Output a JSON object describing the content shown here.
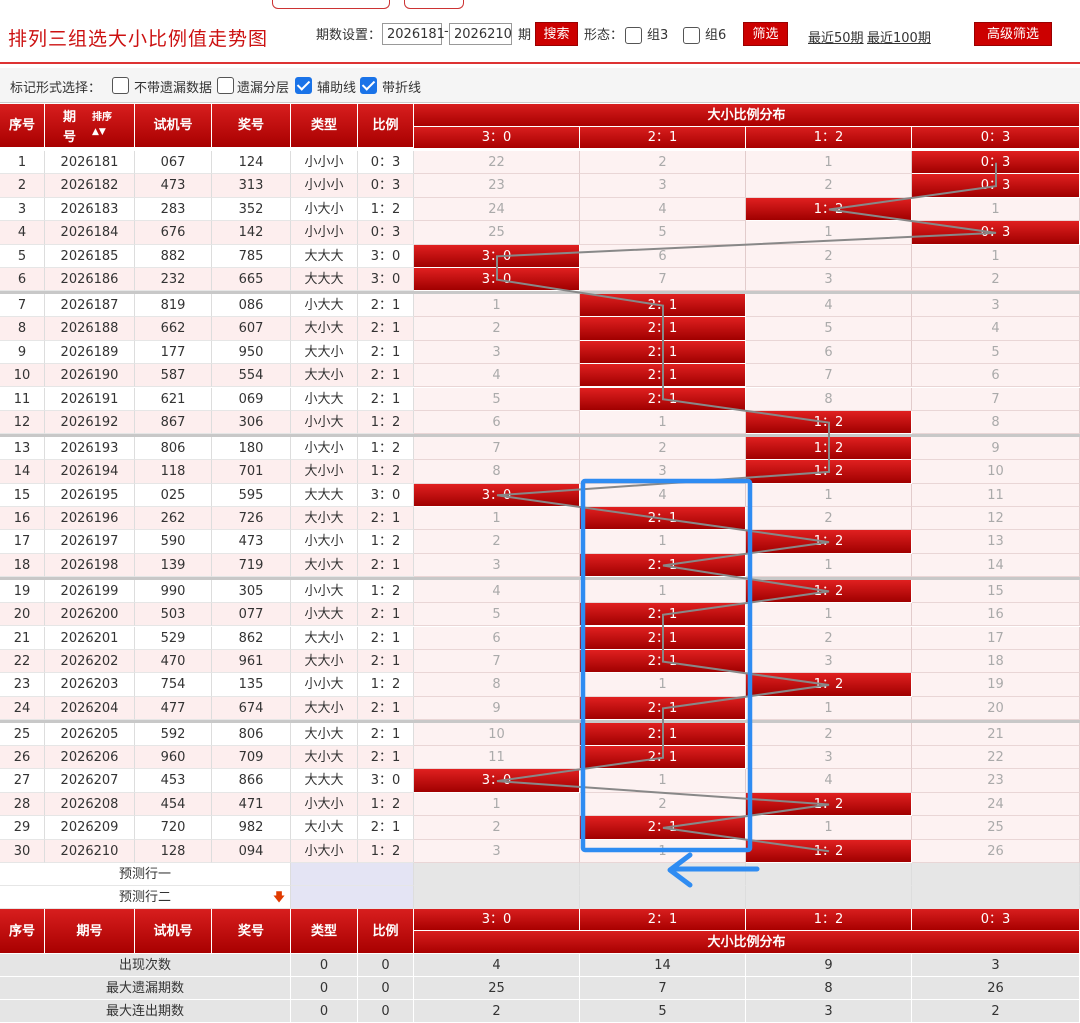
{
  "header": {
    "title": "排列三组选大小比例值走势图",
    "period_label": "期数设置：",
    "period_from": "2026181",
    "dash": "-",
    "period_to": "2026210",
    "period_unit": "期",
    "search_btn": "搜索",
    "form_label": "形态：",
    "g3_label": "组3",
    "g6_label": "组6",
    "filter_btn": "筛选",
    "recent50": "最近50期",
    "recent100": "最近100期",
    "advanced_btn": "高级筛选"
  },
  "markbar": {
    "label": "标记形式选择：",
    "opt1": "不带遗漏数据",
    "opt2": "遗漏分层",
    "opt3": "辅助线",
    "opt4": "带折线",
    "opt1_checked": false,
    "opt2_checked": false,
    "opt3_checked": true,
    "opt4_checked": true
  },
  "table": {
    "h_seq": "序号",
    "h_issue_1": "期",
    "h_issue_2": "号",
    "h_sort": "排序",
    "h_test": "试机号",
    "h_prize": "奖号",
    "h_type": "类型",
    "h_ratio": "比例",
    "h_group": "大小比例分布",
    "cols": [
      "3：0",
      "2：1",
      "1：2",
      "0：3"
    ],
    "rows": [
      {
        "seq": "1",
        "issue": "2026181",
        "test": "067",
        "prize": "124",
        "type": "小小小",
        "ratio": "0：3",
        "hit": 3,
        "cells": [
          "22",
          "2",
          "1",
          "0：3"
        ]
      },
      {
        "seq": "2",
        "issue": "2026182",
        "test": "473",
        "prize": "313",
        "type": "小小小",
        "ratio": "0：3",
        "hit": 3,
        "cells": [
          "23",
          "3",
          "2",
          "0：3"
        ]
      },
      {
        "seq": "3",
        "issue": "2026183",
        "test": "283",
        "prize": "352",
        "type": "小大小",
        "ratio": "1：2",
        "hit": 2,
        "cells": [
          "24",
          "4",
          "1：2",
          "1"
        ]
      },
      {
        "seq": "4",
        "issue": "2026184",
        "test": "676",
        "prize": "142",
        "type": "小小小",
        "ratio": "0：3",
        "hit": 3,
        "cells": [
          "25",
          "5",
          "1",
          "0：3"
        ]
      },
      {
        "seq": "5",
        "issue": "2026185",
        "test": "882",
        "prize": "785",
        "type": "大大大",
        "ratio": "3：0",
        "hit": 0,
        "cells": [
          "3：0",
          "6",
          "2",
          "1"
        ]
      },
      {
        "seq": "6",
        "issue": "2026186",
        "test": "232",
        "prize": "665",
        "type": "大大大",
        "ratio": "3：0",
        "hit": 0,
        "cells": [
          "3：0",
          "7",
          "3",
          "2"
        ]
      },
      {
        "seq": "7",
        "issue": "2026187",
        "test": "819",
        "prize": "086",
        "type": "小大大",
        "ratio": "2：1",
        "hit": 1,
        "cells": [
          "1",
          "2：1",
          "4",
          "3"
        ]
      },
      {
        "seq": "8",
        "issue": "2026188",
        "test": "662",
        "prize": "607",
        "type": "大小大",
        "ratio": "2：1",
        "hit": 1,
        "cells": [
          "2",
          "2：1",
          "5",
          "4"
        ]
      },
      {
        "seq": "9",
        "issue": "2026189",
        "test": "177",
        "prize": "950",
        "type": "大大小",
        "ratio": "2：1",
        "hit": 1,
        "cells": [
          "3",
          "2：1",
          "6",
          "5"
        ]
      },
      {
        "seq": "10",
        "issue": "2026190",
        "test": "587",
        "prize": "554",
        "type": "大大小",
        "ratio": "2：1",
        "hit": 1,
        "cells": [
          "4",
          "2：1",
          "7",
          "6"
        ]
      },
      {
        "seq": "11",
        "issue": "2026191",
        "test": "621",
        "prize": "069",
        "type": "小大大",
        "ratio": "2：1",
        "hit": 1,
        "cells": [
          "5",
          "2：1",
          "8",
          "7"
        ]
      },
      {
        "seq": "12",
        "issue": "2026192",
        "test": "867",
        "prize": "306",
        "type": "小小大",
        "ratio": "1：2",
        "hit": 2,
        "cells": [
          "6",
          "1",
          "1：2",
          "8"
        ]
      },
      {
        "seq": "13",
        "issue": "2026193",
        "test": "806",
        "prize": "180",
        "type": "小大小",
        "ratio": "1：2",
        "hit": 2,
        "cells": [
          "7",
          "2",
          "1：2",
          "9"
        ]
      },
      {
        "seq": "14",
        "issue": "2026194",
        "test": "118",
        "prize": "701",
        "type": "大小小",
        "ratio": "1：2",
        "hit": 2,
        "cells": [
          "8",
          "3",
          "1：2",
          "10"
        ]
      },
      {
        "seq": "15",
        "issue": "2026195",
        "test": "025",
        "prize": "595",
        "type": "大大大",
        "ratio": "3：0",
        "hit": 0,
        "cells": [
          "3：0",
          "4",
          "1",
          "11"
        ]
      },
      {
        "seq": "16",
        "issue": "2026196",
        "test": "262",
        "prize": "726",
        "type": "大小大",
        "ratio": "2：1",
        "hit": 1,
        "cells": [
          "1",
          "2：1",
          "2",
          "12"
        ]
      },
      {
        "seq": "17",
        "issue": "2026197",
        "test": "590",
        "prize": "473",
        "type": "小大小",
        "ratio": "1：2",
        "hit": 2,
        "cells": [
          "2",
          "1",
          "1：2",
          "13"
        ]
      },
      {
        "seq": "18",
        "issue": "2026198",
        "test": "139",
        "prize": "719",
        "type": "大小大",
        "ratio": "2：1",
        "hit": 1,
        "cells": [
          "3",
          "2：1",
          "1",
          "14"
        ]
      },
      {
        "seq": "19",
        "issue": "2026199",
        "test": "990",
        "prize": "305",
        "type": "小小大",
        "ratio": "1：2",
        "hit": 2,
        "cells": [
          "4",
          "1",
          "1：2",
          "15"
        ]
      },
      {
        "seq": "20",
        "issue": "2026200",
        "test": "503",
        "prize": "077",
        "type": "小大大",
        "ratio": "2：1",
        "hit": 1,
        "cells": [
          "5",
          "2：1",
          "1",
          "16"
        ]
      },
      {
        "seq": "21",
        "issue": "2026201",
        "test": "529",
        "prize": "862",
        "type": "大大小",
        "ratio": "2：1",
        "hit": 1,
        "cells": [
          "6",
          "2：1",
          "2",
          "17"
        ]
      },
      {
        "seq": "22",
        "issue": "2026202",
        "test": "470",
        "prize": "961",
        "type": "大大小",
        "ratio": "2：1",
        "hit": 1,
        "cells": [
          "7",
          "2：1",
          "3",
          "18"
        ]
      },
      {
        "seq": "23",
        "issue": "2026203",
        "test": "754",
        "prize": "135",
        "type": "小小大",
        "ratio": "1：2",
        "hit": 2,
        "cells": [
          "8",
          "1",
          "1：2",
          "19"
        ]
      },
      {
        "seq": "24",
        "issue": "2026204",
        "test": "477",
        "prize": "674",
        "type": "大大小",
        "ratio": "2：1",
        "hit": 1,
        "cells": [
          "9",
          "2：1",
          "1",
          "20"
        ]
      },
      {
        "seq": "25",
        "issue": "2026205",
        "test": "592",
        "prize": "806",
        "type": "大小大",
        "ratio": "2：1",
        "hit": 1,
        "cells": [
          "10",
          "2：1",
          "2",
          "21"
        ]
      },
      {
        "seq": "26",
        "issue": "2026206",
        "test": "960",
        "prize": "709",
        "type": "大小大",
        "ratio": "2：1",
        "hit": 1,
        "cells": [
          "11",
          "2：1",
          "3",
          "22"
        ]
      },
      {
        "seq": "27",
        "issue": "2026207",
        "test": "453",
        "prize": "866",
        "type": "大大大",
        "ratio": "3：0",
        "hit": 0,
        "cells": [
          "3：0",
          "1",
          "4",
          "23"
        ]
      },
      {
        "seq": "28",
        "issue": "2026208",
        "test": "454",
        "prize": "471",
        "type": "小大小",
        "ratio": "1：2",
        "hit": 2,
        "cells": [
          "1",
          "2",
          "1：2",
          "24"
        ]
      },
      {
        "seq": "29",
        "issue": "2026209",
        "test": "720",
        "prize": "982",
        "type": "大小大",
        "ratio": "2：1",
        "hit": 1,
        "cells": [
          "2",
          "2：1",
          "1",
          "25"
        ]
      },
      {
        "seq": "30",
        "issue": "2026210",
        "test": "128",
        "prize": "094",
        "type": "小大小",
        "ratio": "1：2",
        "hit": 2,
        "cells": [
          "3",
          "1",
          "1：2",
          "26"
        ]
      }
    ],
    "predict1": "预测行一",
    "predict2": "预测行二",
    "stats": [
      {
        "label": "出现次数",
        "type": "0",
        "ratio": "0",
        "vals": [
          "4",
          "14",
          "9",
          "3"
        ]
      },
      {
        "label": "最大遗漏期数",
        "type": "0",
        "ratio": "0",
        "vals": [
          "25",
          "7",
          "8",
          "26"
        ]
      },
      {
        "label": "最大连出期数",
        "type": "0",
        "ratio": "0",
        "vals": [
          "2",
          "5",
          "3",
          "2"
        ]
      }
    ]
  },
  "colors": {
    "accent": "#cc0000",
    "annotation": "#2f8cf2",
    "line": "#888888"
  }
}
